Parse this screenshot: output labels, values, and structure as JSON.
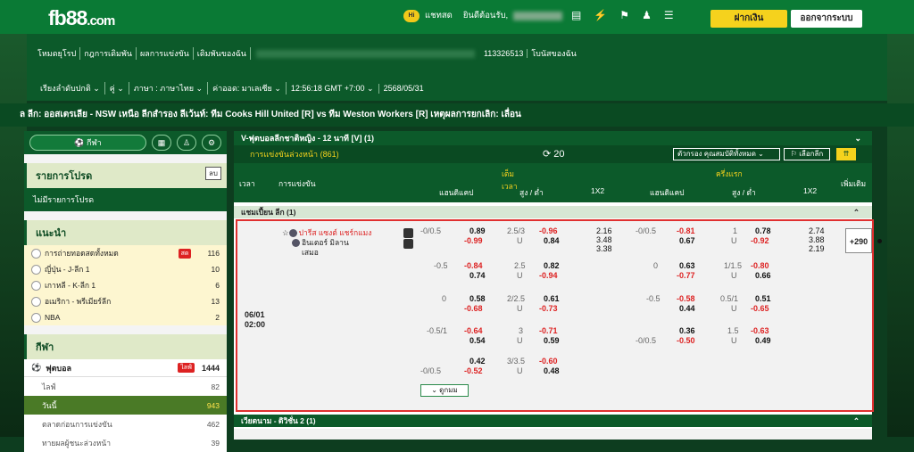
{
  "topbar": {
    "logo": "fb88",
    "logo_suffix": ".com",
    "hi_badge": "Hi",
    "chat": "แชทสด",
    "welcome": "ยินดีต้อนรับ,",
    "deposit": "ฝากเงิน",
    "logout": "ออกจากระบบ",
    "icons": [
      "wallet-icon",
      "bolt-icon",
      "e-sports-icon",
      "user-icon",
      "checklist-icon"
    ]
  },
  "nav1": {
    "links": [
      "โหมดยุโรป",
      "กฎการเดิมพัน",
      "ผลการแข่งขัน",
      "เดิมพันของฉัน"
    ],
    "account_id": "113326513",
    "bonus": "โบนัสของฉัน"
  },
  "nav2": {
    "items": [
      "เรียงลำดับปกติ ⌄",
      "คู่ ⌄",
      "ภาษา : ภาษาไทย ⌄",
      "ค่าออด: มาเลเซีย ⌄",
      "12:56:18 GMT +7:00 ⌄",
      "2568/05/31"
    ]
  },
  "ticker": "ล ลีก: ออสเตรเลีย - NSW เหนือ ลีกสำรอง ลีเว้นท์: ทีม Cooks Hill United [R] vs ทีม Weston Workers [R] เหตุผลการยกเลิก: เลื่อน",
  "sidebar": {
    "sport_pill": "กีฬา",
    "fav_title": "รายการโปรด",
    "fav_tag": "ลบ",
    "fav_empty": "ไม่มีรายการโปรด",
    "rec_title": "แนะนำ",
    "recommended": [
      {
        "name": "การถ่ายทอดสดทั้งหมด",
        "count": "116",
        "badge": "สด"
      },
      {
        "name": "ญี่ปุ่น - J-ลีก 1",
        "count": "10"
      },
      {
        "name": "เกาหลี - K-ลีก 1",
        "count": "6"
      },
      {
        "name": "อเมริกา - พรีเมียร์ลีก",
        "count": "13"
      },
      {
        "name": "NBA",
        "count": "2"
      }
    ],
    "sports_title": "กีฬา",
    "football": {
      "name": "ฟุตบอล",
      "badge": "ไลฟ์",
      "count": "1444"
    },
    "subs": [
      {
        "name": "ไลฟ์",
        "count": "82"
      },
      {
        "name": "วันนี้",
        "count": "943"
      },
      {
        "name": "ตลาดก่อนการแข่งขัน",
        "count": "462"
      },
      {
        "name": "ทายผลผู้ชนะล่วงหน้า",
        "count": "39"
      }
    ]
  },
  "main": {
    "top_league": "V-ฟุตบอลลีกชาติหญิง - 12 นาที [V] (1)",
    "early_label": "การแข่งขันล่วงหน้า (861)",
    "refresh_count": "20",
    "filter": "ตัวกรอง คุณสมบัติทั้งหมด ⌄",
    "pick": "เลือกลีก",
    "cols": {
      "time": "เวลา",
      "match": "การแข่งขัน",
      "full": "เต็มเวลา",
      "half": "ครึ่งแรก",
      "hdp": "แฮนดิแคป",
      "ou": "สูง / ต่ำ",
      "x12": "1X2",
      "more": "เพิ่มเติม"
    },
    "league": "แชมเปี้ยน ลีก (1)",
    "match": {
      "date": "06/01",
      "time": "02:00",
      "home": "ปารีส แซงต์ แชร์กแมง",
      "away": "อินเตอร์ มิลาน",
      "draw": "เสมอ",
      "more": "+290",
      "more_btn": "ดูกมม"
    },
    "lines": [
      {
        "fh": "-0/0.5",
        "f1": "0.89",
        "f2": "-0.99",
        "fo": "2.5/3",
        "fu": "U",
        "fo1": "-0.96",
        "fo2": "0.84",
        "x1": "2.16",
        "x2": "3.48",
        "x3": "3.38",
        "hh": "-0/0.5",
        "h1": "-0.81",
        "h2": "0.67",
        "ho": "1",
        "hu": "U",
        "ho1": "0.78",
        "ho2": "-0.92",
        "hx1": "2.74",
        "hx2": "3.88",
        "hx3": "2.19"
      },
      {
        "fh": "-0.5",
        "f1": "-0.84",
        "f2": "0.74",
        "fo": "2.5",
        "fu": "U",
        "fo1": "0.82",
        "fo2": "-0.94",
        "hh": "0",
        "h1": "0.63",
        "h2": "-0.77",
        "ho": "1/1.5",
        "hu": "U",
        "ho1": "-0.80",
        "ho2": "0.66"
      },
      {
        "fh": "0",
        "f1": "0.58",
        "f2": "-0.68",
        "fo": "2/2.5",
        "fu": "U",
        "fo1": "0.61",
        "fo2": "-0.73",
        "hh": "-0.5",
        "h1": "-0.58",
        "h2": "0.44",
        "ho": "0.5/1",
        "hu": "U",
        "ho1": "0.51",
        "ho2": "-0.65"
      },
      {
        "fh": "-0.5/1",
        "f1": "-0.64",
        "f2": "0.54",
        "fo": "3",
        "fu": "U",
        "fo1": "-0.71",
        "fo2": "0.59",
        "hh": "-0/0.5",
        "h1": "0.36",
        "h2": "-0.50",
        "ho": "1.5",
        "hu": "U",
        "ho1": "-0.63",
        "ho2": "0.49"
      },
      {
        "fh": "-0/0.5",
        "f1": "0.42",
        "f2": "-0.52",
        "fo": "3/3.5",
        "fu": "U",
        "fo1": "-0.60",
        "fo2": "0.48"
      }
    ],
    "league2": "เวียดนาม - ดิวิชั่น 2 (1)"
  }
}
